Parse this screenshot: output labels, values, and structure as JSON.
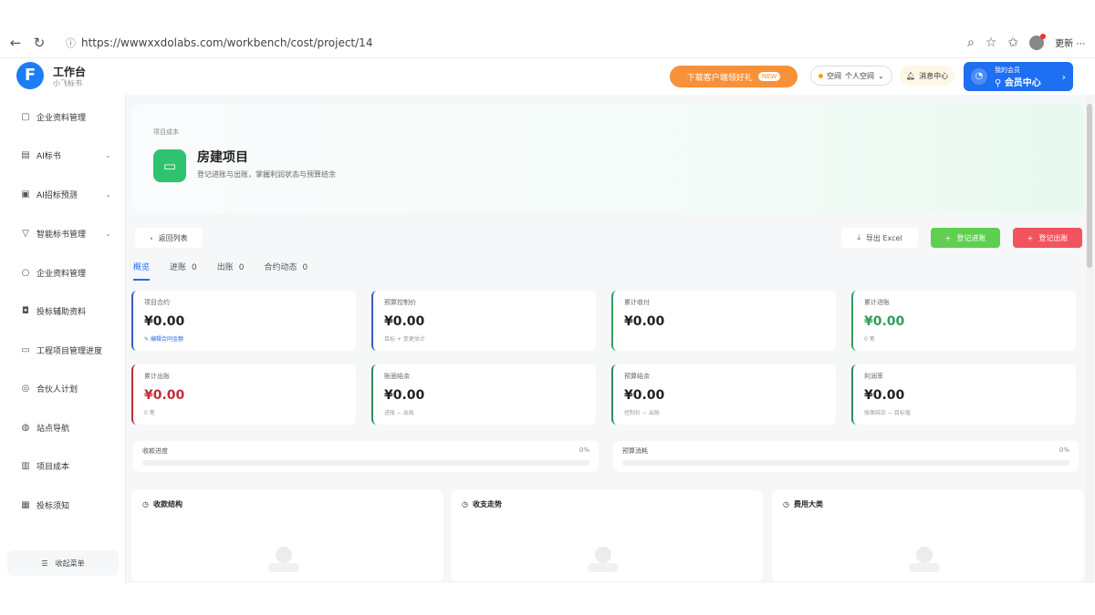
{
  "browser": {
    "url": "https://wwwxxdolabs.com/workbench/cost/project/14",
    "more_label": "更新 ⋯"
  },
  "header": {
    "logo_letter": "F",
    "title": "工作台",
    "subtitle": "小飞标书",
    "promo_label": "下载客户端领好礼",
    "promo_badge": "NEW",
    "select_label": "个人空间",
    "select_prefix": "空间",
    "msg_label": "消息中心",
    "member_top": "我的会员",
    "member_main": "会员中心"
  },
  "sidebar": {
    "items": [
      {
        "label": "企业资料管理",
        "icon": "folder-icon",
        "chevron": false
      },
      {
        "label": "AI标书",
        "icon": "document-icon",
        "chevron": true
      },
      {
        "label": "AI招标预测",
        "icon": "chart-icon",
        "chevron": true
      },
      {
        "label": "智能标书管理",
        "icon": "filter-icon",
        "chevron": true
      },
      {
        "label": "企业资料管理",
        "icon": "search-icon",
        "chevron": false
      },
      {
        "label": "投标辅助资料",
        "icon": "chat-icon",
        "chevron": false
      },
      {
        "label": "工程项目管理进度",
        "icon": "project-icon",
        "chevron": false
      },
      {
        "label": "合伙人计划",
        "icon": "partner-icon",
        "chevron": false
      },
      {
        "label": "站点导航",
        "icon": "nav-icon",
        "chevron": false
      },
      {
        "label": "项目成本",
        "icon": "database-icon",
        "chevron": false
      },
      {
        "label": "投标须知",
        "icon": "notice-icon",
        "chevron": false
      }
    ],
    "collapse_label": "收起菜单"
  },
  "hero": {
    "crumb": "项目成本",
    "title": "房建项目",
    "subtitle": "登记进账与出账，掌握利润状态与预算结余"
  },
  "actions": {
    "back_label": "返回列表",
    "export_label": "导出 Excel",
    "income_label": "登记进账",
    "expense_label": "登记出账"
  },
  "tabs": [
    {
      "label": "概览",
      "count": ""
    },
    {
      "label": "进账",
      "count": "0"
    },
    {
      "label": "出账",
      "count": "0"
    },
    {
      "label": "合约动态",
      "count": "0"
    }
  ],
  "stats": [
    {
      "label": "项目合约",
      "value": "¥0.00",
      "note": "编辑合同金额",
      "color": "#3b5bbf",
      "value_color": "#222222",
      "link": true
    },
    {
      "label": "预算控制价",
      "value": "¥0.00",
      "note": "目标 + 变更估计",
      "color": "#3b5bbf",
      "value_color": "#222222",
      "link": false
    },
    {
      "label": "累计收付",
      "value": "¥0.00",
      "note": "",
      "color": "#2e9e5b",
      "value_color": "#222222",
      "link": false
    },
    {
      "label": "累计进账",
      "value": "¥0.00",
      "note": "0 笔",
      "color": "#2e9e5b",
      "value_color": "#2e9e5b",
      "link": false
    },
    {
      "label": "累计出账",
      "value": "¥0.00",
      "note": "0 笔",
      "color": "#c02d3b",
      "value_color": "#c02d3b",
      "link": false
    },
    {
      "label": "账面结余",
      "value": "¥0.00",
      "note": "进账 − 出账",
      "color": "#2e8a5b",
      "value_color": "#222222",
      "link": false
    },
    {
      "label": "预算结余",
      "value": "¥0.00",
      "note": "控制价 − 出账",
      "color": "#2e8a5b",
      "value_color": "#222222",
      "link": false
    },
    {
      "label": "利润率",
      "value": "¥0.00",
      "note": "账面结余 − 目标值",
      "color": "#2e8a5b",
      "value_color": "#222222",
      "link": false
    }
  ],
  "progress": [
    {
      "label": "收款进度",
      "pct": "0%",
      "value": 0
    },
    {
      "label": "预算消耗",
      "pct": "0%",
      "value": 0
    }
  ],
  "panels": [
    {
      "title": "收款结构"
    },
    {
      "title": "收支走势"
    },
    {
      "title": "费用大类"
    }
  ]
}
